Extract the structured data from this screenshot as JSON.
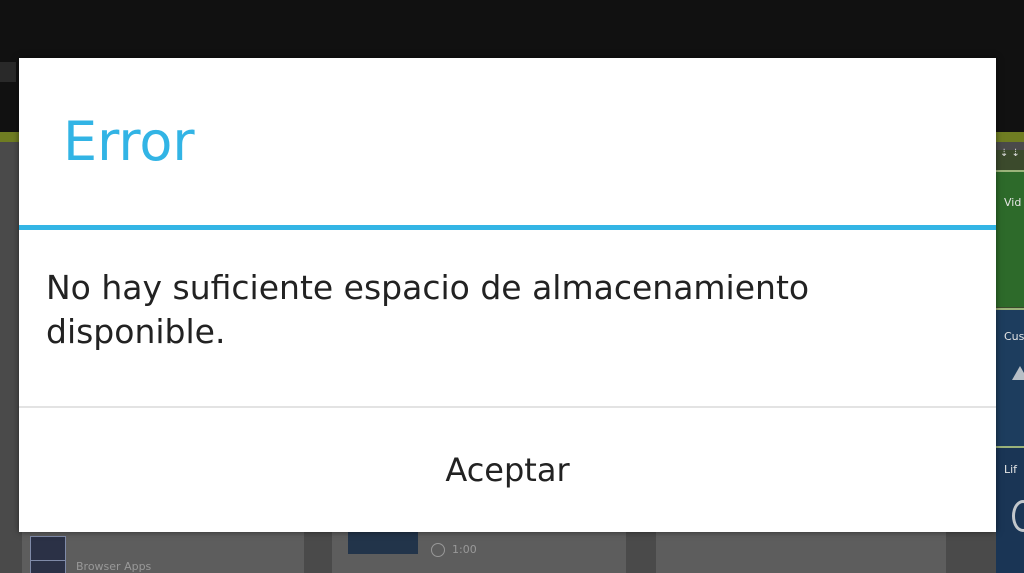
{
  "dialog": {
    "title": "Error",
    "message": "No hay suficiente espacio de almacenamiento disponible.",
    "button_label": "Aceptar",
    "accent_color": "#33b5e5"
  },
  "background": {
    "left_item_label": "Browser Apps",
    "video_duration": "1:00",
    "right_tiles": [
      "Vid",
      "Custo",
      "Lif"
    ]
  }
}
